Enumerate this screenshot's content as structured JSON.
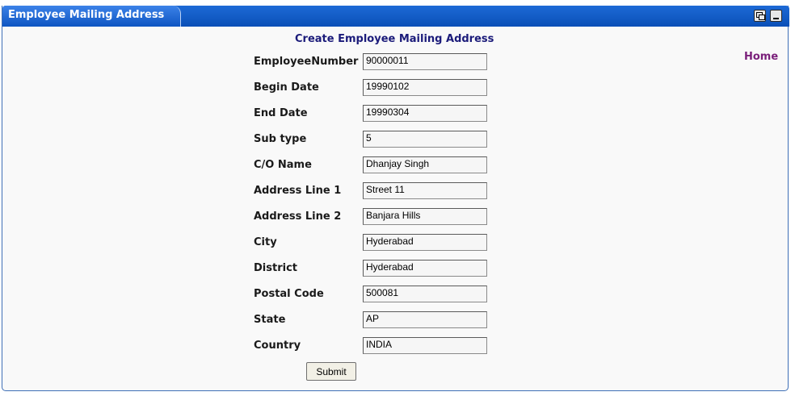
{
  "portlet": {
    "title": "Employee Mailing Address"
  },
  "form": {
    "heading": "Create Employee Mailing Address",
    "home_link": "Home",
    "fields": [
      {
        "label": "EmployeeNumber",
        "value": "90000011"
      },
      {
        "label": "Begin Date",
        "value": "19990102"
      },
      {
        "label": "End Date",
        "value": "19990304"
      },
      {
        "label": "Sub type",
        "value": "5"
      },
      {
        "label": "C/O Name",
        "value": "Dhanjay Singh"
      },
      {
        "label": "Address Line 1",
        "value": "Street 11"
      },
      {
        "label": "Address Line 2",
        "value": "Banjara Hills"
      },
      {
        "label": "City",
        "value": "Hyderabad"
      },
      {
        "label": "District",
        "value": "Hyderabad"
      },
      {
        "label": "Postal Code",
        "value": "500081"
      },
      {
        "label": "State",
        "value": "AP"
      },
      {
        "label": "Country",
        "value": "INDIA"
      }
    ],
    "submit_label": "Submit"
  },
  "icons": {
    "restore": "restore-window-icon",
    "minimize": "minimize-window-icon"
  },
  "colors": {
    "titlebar": "#0a4fb7",
    "heading": "#1b1b7a",
    "home_link": "#7a1f7a"
  }
}
